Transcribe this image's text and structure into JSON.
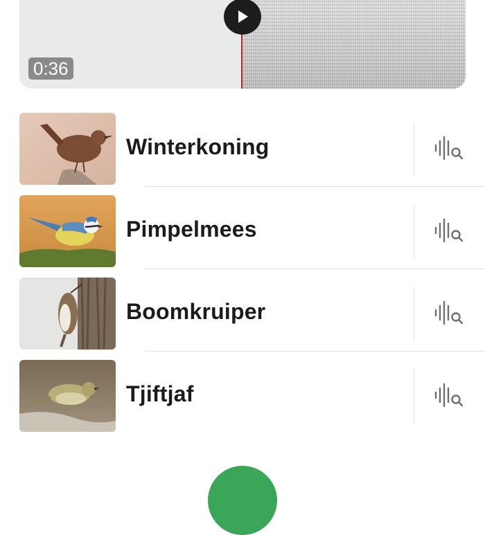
{
  "player": {
    "time": "0:36",
    "play_icon": "play-icon",
    "playhead_color": "#c62828"
  },
  "species": [
    {
      "name": "Winterkoning",
      "icon": "analyze-sound-icon"
    },
    {
      "name": "Pimpelmees",
      "icon": "analyze-sound-icon"
    },
    {
      "name": "Boomkruiper",
      "icon": "analyze-sound-icon"
    },
    {
      "name": "Tjiftjaf",
      "icon": "analyze-sound-icon"
    }
  ],
  "colors": {
    "accent_green": "#3aa657",
    "text": "#1b1b1b",
    "icon_gray": "#6e6e6e"
  }
}
